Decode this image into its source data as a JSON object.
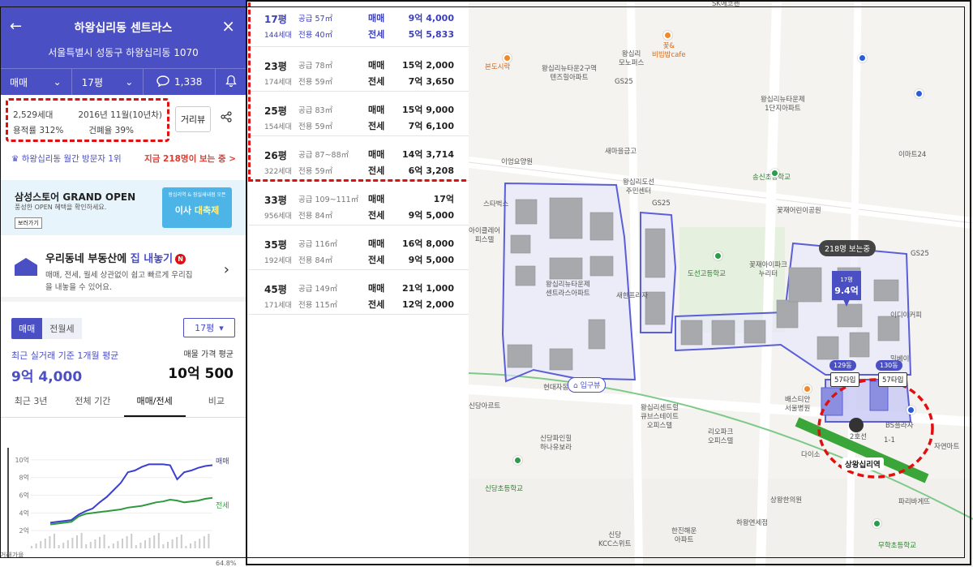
{
  "header": {
    "title": "하왕십리동 센트라스",
    "address": "서울특별시 성동구 하왕십리동 1070",
    "trade_type": "매매",
    "pyeong": "17평",
    "comment_count": "1,338"
  },
  "info": {
    "households": "2,529세대",
    "built": "2016년 11월(10년차)",
    "floor_area_ratio": "용적률 312%",
    "coverage_ratio": "건폐율 39%",
    "street_view_label": "거리뷰"
  },
  "visit": {
    "rank": "하왕십리동 월간 방문자 1위",
    "now_viewing": "지금 218명이 보는 중 >"
  },
  "banner": {
    "title": "삼성스토어 GRAND OPEN",
    "subtitle": "풍성한 OPEN 혜택을 확인하세요.",
    "button": "보러가기",
    "image_top": "왕십리역 & 잠실새내점 오픈",
    "image_text_1": "이사",
    "image_text_2": "대축제"
  },
  "sell": {
    "title_prefix": "우리동네 부동산에",
    "title_emph": "집 내놓기",
    "badge": "N",
    "desc": "매매, 전세, 월세 상관없이 쉽고 빠르게 우리집을 내놓을 수 있어요."
  },
  "price_panel": {
    "tab_trade": "매매",
    "tab_rent": "전월세",
    "pyeong_select": "17평",
    "avg_label": "최근 실거래 기준 1개월 평균",
    "avg_value": "9억 4,000",
    "listing_label": "매물 가격 평균",
    "listing_value": "10억 500",
    "period_tabs": [
      "최근 3년",
      "전체 기간",
      "매매/전세",
      "비교"
    ]
  },
  "chart_data": {
    "type": "line",
    "yticks": [
      "10억",
      "8억",
      "6억",
      "4억",
      "2억"
    ],
    "ylim": [
      0,
      11
    ],
    "series": [
      {
        "name": "매매",
        "color": "#3b3fd0",
        "values": [
          2.9,
          3.0,
          3.1,
          3.2,
          3.8,
          4.2,
          4.5,
          5.2,
          5.8,
          6.6,
          7.4,
          8.6,
          8.8,
          9.2,
          9.5,
          9.5,
          9.5,
          9.4,
          7.8,
          8.6,
          8.8,
          9.1,
          9.3,
          9.4
        ]
      },
      {
        "name": "전세",
        "color": "#2e9a3e",
        "values": [
          2.7,
          2.8,
          2.9,
          3.0,
          3.6,
          3.9,
          4.0,
          4.1,
          4.2,
          4.3,
          4.4,
          4.6,
          4.7,
          4.8,
          5.0,
          5.2,
          5.3,
          5.5,
          5.4,
          5.2,
          5.3,
          5.4,
          5.6,
          5.7
        ]
      }
    ],
    "bottom_labels": [
      "거래가율",
      "64.8%"
    ]
  },
  "table": [
    {
      "pyeong": "17평",
      "households": "144세대",
      "supply": "공급 57㎡",
      "exclusive": "전용 40㎡",
      "trade": "매매",
      "trade_price": "9억 4,000",
      "lease": "전세",
      "lease_price": "5억 5,833"
    },
    {
      "pyeong": "23평",
      "households": "174세대",
      "supply": "공급 78㎡",
      "exclusive": "전용 59㎡",
      "trade": "매매",
      "trade_price": "15억 2,000",
      "lease": "전세",
      "lease_price": "7억 3,650"
    },
    {
      "pyeong": "25평",
      "households": "154세대",
      "supply": "공급 83㎡",
      "exclusive": "전용 59㎡",
      "trade": "매매",
      "trade_price": "15억 9,000",
      "lease": "전세",
      "lease_price": "7억 6,100"
    },
    {
      "pyeong": "26평",
      "households": "322세대",
      "supply": "공급 87~88㎡",
      "exclusive": "전용 59㎡",
      "trade": "매매",
      "trade_price": "14억 3,714",
      "lease": "전세",
      "lease_price": "6억 3,208"
    },
    {
      "pyeong": "33평",
      "households": "956세대",
      "supply": "공급 109~111㎡",
      "exclusive": "전용 84㎡",
      "trade": "매매",
      "trade_price": "17억",
      "lease": "전세",
      "lease_price": "9억 5,000"
    },
    {
      "pyeong": "35평",
      "households": "192세대",
      "supply": "공급 116㎡",
      "exclusive": "전용 84㎡",
      "trade": "매매",
      "trade_price": "16억 8,000",
      "lease": "전세",
      "lease_price": "9억 5,000"
    },
    {
      "pyeong": "45평",
      "households": "171세대",
      "supply": "공급 149㎡",
      "exclusive": "전용 115㎡",
      "trade": "매매",
      "trade_price": "21억 1,000",
      "lease": "전세",
      "lease_price": "12억 2,000"
    }
  ],
  "map": {
    "viewers_bubble": "218명 보는중",
    "price_pin_size": "17평",
    "price_pin_value": "9.4억",
    "entry_label": "입구뷰",
    "dong_129": "129동",
    "dong_130": "130동",
    "type_57a": "57타입",
    "type_57b": "57타입",
    "station_name": "상왕십리역",
    "line2": "2호선",
    "exit_label": "1-1",
    "labels": [
      "SK에코펜",
      "본도시락",
      "왕십리뉴타운2구역\n텐즈힐아파트",
      "왕십리\n모노퍼스",
      "GS25",
      "왕십리뉴타운제\n1단지아파트",
      "이마트24",
      "새마을금고",
      "송신초등학교",
      "왕십리도선\n주민센터",
      "GS25",
      "꽃재어린이공원",
      "이엄요양원",
      "스타벅스",
      "아이클레어\n피스텔",
      "도선고등학교",
      "꽃재아이파크\n누리터",
      "왕십리뉴타운제\n센트라스아파트",
      "새한프라자",
      "이디야커피",
      "GS25",
      "밀베이",
      "배스티안\n서울병원",
      "현대자동차",
      "왕십리센트럴\n큐브스테이트\n오피스텔",
      "리오파크\n오피스텔",
      "신당파인힐\n하나유보라",
      "BS플라자",
      "자연마트",
      "다이소",
      "신당초등학교",
      "하왕연세점",
      "상왕한의원",
      "한진해운\n아파트",
      "신당\nKCC스위트",
      "파리바게뜨",
      "무학초등학교",
      "신당아르트",
      "꽃&\n비빔밥cafe"
    ]
  }
}
